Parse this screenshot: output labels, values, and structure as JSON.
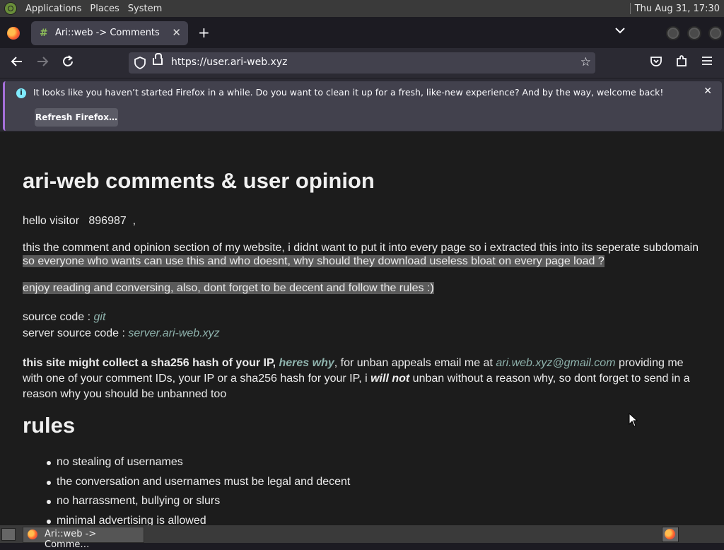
{
  "system": {
    "menus": [
      "Applications",
      "Places",
      "System"
    ],
    "clock": "Thu Aug 31, 17:30"
  },
  "browser": {
    "tab_title": "Ari::web -> Comments",
    "tab_favicon": "#",
    "url": "https://user.ari-web.xyz",
    "notification": {
      "message": "It looks like you haven’t started Firefox in a while. Do you want to clean it up for a fresh, like-new experience? And by the way, welcome back!",
      "button": "Refresh Firefox…"
    }
  },
  "page": {
    "title": "ari-web comments & user opinion",
    "visitor_prefix": "hello visitor",
    "visitor_id": "896987",
    "visitor_suffix": ",",
    "intro_line1": "this the comment and opinion section of my website, i didnt want to put it into every page so i extracted this into its seperate subdomain",
    "intro_line2": "so everyone who wants can use this and who doesnt, why should they download useless bloat on every page load ?",
    "enjoy": "enjoy reading and conversing, also, dont forget to be decent and follow the rules :)",
    "source_label": "source code : ",
    "source_link": "git",
    "server_label": "server source code : ",
    "server_link": "server.ari-web.xyz",
    "privacy_bold": "this site might collect a sha256 hash of your IP,",
    "privacy_link": "heres why",
    "privacy_mid": ", for unban appeals email me at ",
    "email": "ari.web.xyz@gmail.com",
    "privacy_tail1": " providing me",
    "privacy_line2a": "with one of your comment IDs, your IP or a sha256 hash for your IP, i ",
    "will_not": "will not",
    "privacy_line2b": " unban without a reason why, so dont forget to send in a",
    "privacy_line3": "reason why you should be unbanned too",
    "rules_heading": "rules",
    "rules": [
      "no stealing of usernames",
      "the conversation and usernames must be legal and decent",
      "no harrassment, bullying or slurs",
      "minimal advertising is allowed"
    ]
  },
  "taskbar": {
    "task_title": "Ari::web -> Comme…"
  }
}
